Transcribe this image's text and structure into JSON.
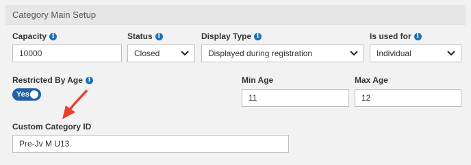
{
  "header": {
    "title": "Category Main Setup"
  },
  "capacity": {
    "label": "Capacity",
    "value": "10000"
  },
  "status": {
    "label": "Status",
    "value": "Closed"
  },
  "display_type": {
    "label": "Display Type",
    "value": "Displayed during registration"
  },
  "is_used_for": {
    "label": "Is used for",
    "value": "Individual"
  },
  "restricted_by_age": {
    "label": "Restricted By Age",
    "toggle_text": "Yes",
    "enabled": true
  },
  "min_age": {
    "label": "Min Age",
    "value": "11"
  },
  "max_age": {
    "label": "Max Age",
    "value": "12"
  },
  "custom_category_id": {
    "label": "Custom Category ID",
    "value": "Pre-Jv M U13"
  },
  "info_glyph": "i",
  "colors": {
    "accent": "#1f5fa8",
    "annotation_arrow": "#e8402a"
  }
}
